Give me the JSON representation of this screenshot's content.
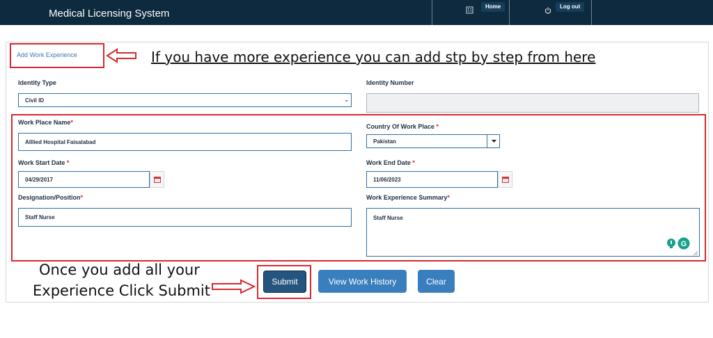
{
  "header": {
    "app_title": "Medical Licensing System",
    "home_label": "Home",
    "logout_label": "Log out"
  },
  "tab_link": "Add Work Experience",
  "annotations": {
    "top_note": "If you have more experience you can add stp by step from here",
    "bottom_note_line1": "Once you add all your",
    "bottom_note_line2": "Experience Click Submit"
  },
  "form": {
    "identity_type": {
      "label": "Identity Type",
      "value": "Civil ID"
    },
    "identity_number": {
      "label": "Identity Number",
      "value": ""
    },
    "work_place_name": {
      "label": "Work Place Name",
      "required": "*",
      "value": "Alllied Hospital Faisalabad"
    },
    "country": {
      "label": "Country Of Work Place",
      "required": "*",
      "value": "Pakistan"
    },
    "start_date": {
      "label": "Work Start Date",
      "required": "*",
      "value": "04/29/2017"
    },
    "end_date": {
      "label": "Work End Date",
      "required": "*",
      "value": "11/06/2023"
    },
    "designation": {
      "label": "Designation/Position",
      "required": "*",
      "value": "Staff Nurse"
    },
    "summary": {
      "label": "Work Experience Summary",
      "required": "*",
      "value": "Staff Nurse"
    }
  },
  "buttons": {
    "submit": "Submit",
    "view_history": "View Work History",
    "clear": "Clear"
  },
  "colors": {
    "header_bg": "#0d2a3e",
    "accent_blue": "#3a7fbd",
    "highlight_red": "#d7282f",
    "field_border": "#2e6fa3"
  },
  "icons": [
    "building-icon",
    "power-icon",
    "calendar-icon",
    "chevron-down-icon",
    "caret-down-icon",
    "arrow-right-icon",
    "arrow-left-icon",
    "grammarly-icon",
    "lightbulb-icon"
  ]
}
